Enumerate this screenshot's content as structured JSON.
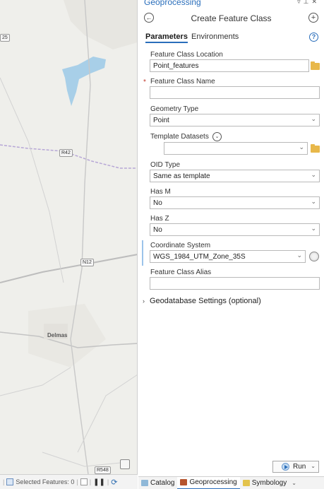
{
  "map": {
    "labels": {
      "edge_road": "25",
      "road_r42": "R42",
      "road_n12": "N12",
      "town": "Delmas",
      "road_r548": "R548"
    }
  },
  "statusbar": {
    "selected_features": "Selected Features: 0"
  },
  "pane": {
    "title": "Geoprocessing",
    "tool_title": "Create Feature Class",
    "tabs": [
      "Parameters",
      "Environments"
    ],
    "params": {
      "location_label": "Feature Class Location",
      "location_value": "Point_features",
      "name_label": "Feature Class Name",
      "name_value": "",
      "geometry_label": "Geometry Type",
      "geometry_value": "Point",
      "template_label": "Template Datasets",
      "template_value": "",
      "oid_label": "OID Type",
      "oid_value": "Same as template",
      "hasm_label": "Has M",
      "hasm_value": "No",
      "hasz_label": "Has Z",
      "hasz_value": "No",
      "crs_label": "Coordinate System",
      "crs_value": "WGS_1984_UTM_Zone_35S",
      "alias_label": "Feature Class Alias",
      "alias_value": ""
    },
    "gdb_settings": "Geodatabase Settings (optional)",
    "run_label": "Run"
  },
  "bottom_tabs": [
    "Catalog",
    "Geoprocessing",
    "Symbology"
  ],
  "colors": {
    "accent": "#2a6ebb",
    "required": "#c0392b",
    "water": "#a8cfe8",
    "folder": "#e8b84a"
  }
}
